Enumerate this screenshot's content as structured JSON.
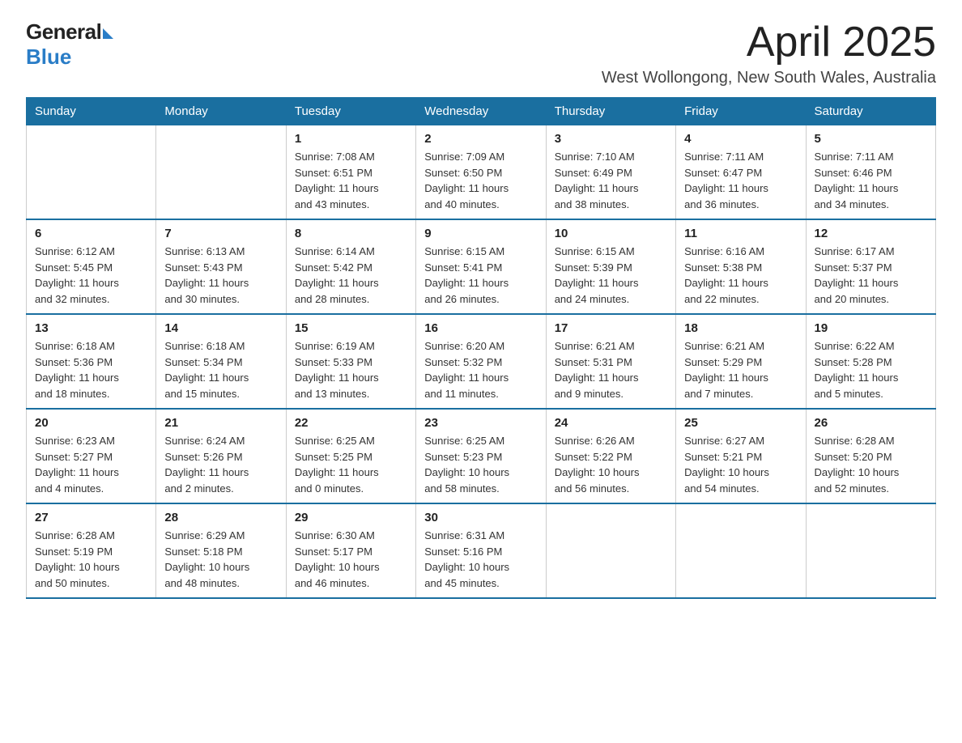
{
  "header": {
    "logo_general": "General",
    "logo_blue": "Blue",
    "title": "April 2025",
    "location": "West Wollongong, New South Wales, Australia"
  },
  "weekdays": [
    "Sunday",
    "Monday",
    "Tuesday",
    "Wednesday",
    "Thursday",
    "Friday",
    "Saturday"
  ],
  "weeks": [
    [
      {
        "day": "",
        "info": ""
      },
      {
        "day": "",
        "info": ""
      },
      {
        "day": "1",
        "info": "Sunrise: 7:08 AM\nSunset: 6:51 PM\nDaylight: 11 hours\nand 43 minutes."
      },
      {
        "day": "2",
        "info": "Sunrise: 7:09 AM\nSunset: 6:50 PM\nDaylight: 11 hours\nand 40 minutes."
      },
      {
        "day": "3",
        "info": "Sunrise: 7:10 AM\nSunset: 6:49 PM\nDaylight: 11 hours\nand 38 minutes."
      },
      {
        "day": "4",
        "info": "Sunrise: 7:11 AM\nSunset: 6:47 PM\nDaylight: 11 hours\nand 36 minutes."
      },
      {
        "day": "5",
        "info": "Sunrise: 7:11 AM\nSunset: 6:46 PM\nDaylight: 11 hours\nand 34 minutes."
      }
    ],
    [
      {
        "day": "6",
        "info": "Sunrise: 6:12 AM\nSunset: 5:45 PM\nDaylight: 11 hours\nand 32 minutes."
      },
      {
        "day": "7",
        "info": "Sunrise: 6:13 AM\nSunset: 5:43 PM\nDaylight: 11 hours\nand 30 minutes."
      },
      {
        "day": "8",
        "info": "Sunrise: 6:14 AM\nSunset: 5:42 PM\nDaylight: 11 hours\nand 28 minutes."
      },
      {
        "day": "9",
        "info": "Sunrise: 6:15 AM\nSunset: 5:41 PM\nDaylight: 11 hours\nand 26 minutes."
      },
      {
        "day": "10",
        "info": "Sunrise: 6:15 AM\nSunset: 5:39 PM\nDaylight: 11 hours\nand 24 minutes."
      },
      {
        "day": "11",
        "info": "Sunrise: 6:16 AM\nSunset: 5:38 PM\nDaylight: 11 hours\nand 22 minutes."
      },
      {
        "day": "12",
        "info": "Sunrise: 6:17 AM\nSunset: 5:37 PM\nDaylight: 11 hours\nand 20 minutes."
      }
    ],
    [
      {
        "day": "13",
        "info": "Sunrise: 6:18 AM\nSunset: 5:36 PM\nDaylight: 11 hours\nand 18 minutes."
      },
      {
        "day": "14",
        "info": "Sunrise: 6:18 AM\nSunset: 5:34 PM\nDaylight: 11 hours\nand 15 minutes."
      },
      {
        "day": "15",
        "info": "Sunrise: 6:19 AM\nSunset: 5:33 PM\nDaylight: 11 hours\nand 13 minutes."
      },
      {
        "day": "16",
        "info": "Sunrise: 6:20 AM\nSunset: 5:32 PM\nDaylight: 11 hours\nand 11 minutes."
      },
      {
        "day": "17",
        "info": "Sunrise: 6:21 AM\nSunset: 5:31 PM\nDaylight: 11 hours\nand 9 minutes."
      },
      {
        "day": "18",
        "info": "Sunrise: 6:21 AM\nSunset: 5:29 PM\nDaylight: 11 hours\nand 7 minutes."
      },
      {
        "day": "19",
        "info": "Sunrise: 6:22 AM\nSunset: 5:28 PM\nDaylight: 11 hours\nand 5 minutes."
      }
    ],
    [
      {
        "day": "20",
        "info": "Sunrise: 6:23 AM\nSunset: 5:27 PM\nDaylight: 11 hours\nand 4 minutes."
      },
      {
        "day": "21",
        "info": "Sunrise: 6:24 AM\nSunset: 5:26 PM\nDaylight: 11 hours\nand 2 minutes."
      },
      {
        "day": "22",
        "info": "Sunrise: 6:25 AM\nSunset: 5:25 PM\nDaylight: 11 hours\nand 0 minutes."
      },
      {
        "day": "23",
        "info": "Sunrise: 6:25 AM\nSunset: 5:23 PM\nDaylight: 10 hours\nand 58 minutes."
      },
      {
        "day": "24",
        "info": "Sunrise: 6:26 AM\nSunset: 5:22 PM\nDaylight: 10 hours\nand 56 minutes."
      },
      {
        "day": "25",
        "info": "Sunrise: 6:27 AM\nSunset: 5:21 PM\nDaylight: 10 hours\nand 54 minutes."
      },
      {
        "day": "26",
        "info": "Sunrise: 6:28 AM\nSunset: 5:20 PM\nDaylight: 10 hours\nand 52 minutes."
      }
    ],
    [
      {
        "day": "27",
        "info": "Sunrise: 6:28 AM\nSunset: 5:19 PM\nDaylight: 10 hours\nand 50 minutes."
      },
      {
        "day": "28",
        "info": "Sunrise: 6:29 AM\nSunset: 5:18 PM\nDaylight: 10 hours\nand 48 minutes."
      },
      {
        "day": "29",
        "info": "Sunrise: 6:30 AM\nSunset: 5:17 PM\nDaylight: 10 hours\nand 46 minutes."
      },
      {
        "day": "30",
        "info": "Sunrise: 6:31 AM\nSunset: 5:16 PM\nDaylight: 10 hours\nand 45 minutes."
      },
      {
        "day": "",
        "info": ""
      },
      {
        "day": "",
        "info": ""
      },
      {
        "day": "",
        "info": ""
      }
    ]
  ]
}
